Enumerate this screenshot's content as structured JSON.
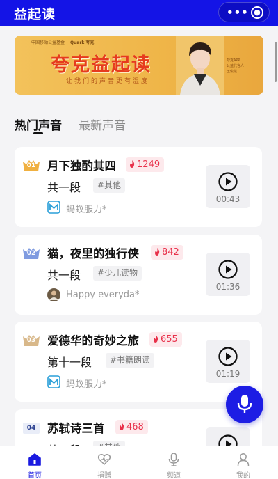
{
  "app": {
    "title": "益起读"
  },
  "capsule": {
    "more": "•••"
  },
  "banner": {
    "logos_text": "中国移动公益基金",
    "quark_text": "Quark 夸克",
    "headline": "夸克益起读",
    "slogan": "让我们的声音更有温度",
    "side_line1": "夸克APP",
    "side_line2": "公益代言人",
    "side_line3": "王俊凯"
  },
  "tabs": [
    {
      "label": "热门声音",
      "active": true
    },
    {
      "label": "最新声音",
      "active": false
    }
  ],
  "items": [
    {
      "rank": "01",
      "title": "月下独酌其四",
      "heat": "1249",
      "segment": "共一段",
      "tag": "#其他",
      "author": "蚂蚁服力*",
      "duration": "00:43"
    },
    {
      "rank": "02",
      "title": "猫，夜里的独行侠",
      "heat": "842",
      "segment": "共一段",
      "tag": "#少儿读物",
      "author": "Happy everyda*",
      "duration": "01:36"
    },
    {
      "rank": "03",
      "title": "爱德华的奇妙之旅",
      "heat": "655",
      "segment": "第十一段",
      "tag": "#书籍朗读",
      "author": "蚂蚁服力*",
      "duration": "01:19"
    },
    {
      "rank": "04",
      "title": "苏轼诗三首",
      "heat": "468",
      "segment": "共一段",
      "tag": "#其他",
      "author": "",
      "duration": ""
    }
  ],
  "colors": {
    "brand": "#1414e6",
    "heat": "#e8304a",
    "gold": "#f0b040",
    "silver": "#7f9be0",
    "bronze": "#d8b88a"
  },
  "tabbar": [
    {
      "label": "首页",
      "icon": "home-icon",
      "active": true
    },
    {
      "label": "捐赠",
      "icon": "heart-donate-icon",
      "active": false
    },
    {
      "label": "频道",
      "icon": "microphone-icon",
      "active": false
    },
    {
      "label": "我的",
      "icon": "person-icon",
      "active": false
    }
  ]
}
